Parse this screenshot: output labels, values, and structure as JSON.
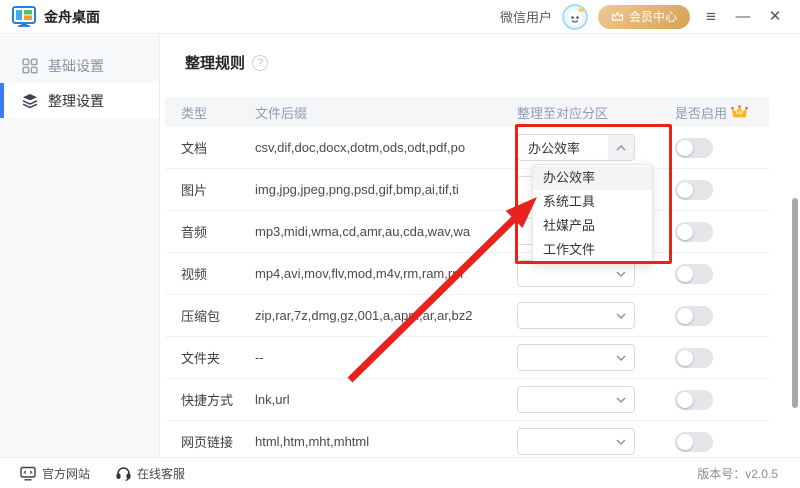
{
  "titlebar": {
    "app_name": "金舟桌面",
    "user_name": "微信用户",
    "member_label": "会员中心",
    "menu_icon": "≡",
    "minimize_icon": "—",
    "close_icon": "✕"
  },
  "sidebar": {
    "items": [
      {
        "label": "基础设置",
        "active": false
      },
      {
        "label": "整理设置",
        "active": true
      }
    ]
  },
  "main": {
    "title": "整理规则",
    "help_icon": "?",
    "table": {
      "headers": [
        "类型",
        "文件后缀",
        "整理至对应分区",
        "是否启用"
      ],
      "rows": [
        {
          "type": "文档",
          "extensions": "csv,dif,doc,docx,dotm,ods,odt,pdf,po",
          "partition": "办公效率",
          "enabled": false
        },
        {
          "type": "图片",
          "extensions": "img,jpg,jpeg,png,psd,gif,bmp,ai,tif,ti",
          "partition": "",
          "enabled": false
        },
        {
          "type": "音频",
          "extensions": "mp3,midi,wma,cd,amr,au,cda,wav,wa",
          "partition": "",
          "enabled": false
        },
        {
          "type": "视频",
          "extensions": "mp4,avi,mov,flv,mod,m4v,rm,ram,rm",
          "partition": "",
          "enabled": false
        },
        {
          "type": "压缩包",
          "extensions": "zip,rar,7z,dmg,gz,001,a,apm,ar,ar,bz2",
          "partition": "",
          "enabled": false
        },
        {
          "type": "文件夹",
          "extensions": "--",
          "partition": "",
          "enabled": false
        },
        {
          "type": "快捷方式",
          "extensions": "lnk,url",
          "partition": "",
          "enabled": false
        },
        {
          "type": "网页链接",
          "extensions": "html,htm,mht,mhtml",
          "partition": "",
          "enabled": false
        }
      ]
    },
    "dropdown": {
      "selected": "办公效率",
      "options": [
        "办公效率",
        "系统工具",
        "社媒产品",
        "工作文件"
      ]
    }
  },
  "footer": {
    "website": "官方网站",
    "support": "在线客服",
    "version": "版本号：v2.0.5"
  },
  "colors": {
    "accent_blue": "#3b7cfa",
    "member_gold": "#d7a053",
    "annotation_red": "#ec2217",
    "header_text": "#8f9cb0",
    "toggle_off": "#e3e5e8",
    "vip_crown": "#ffb614"
  }
}
